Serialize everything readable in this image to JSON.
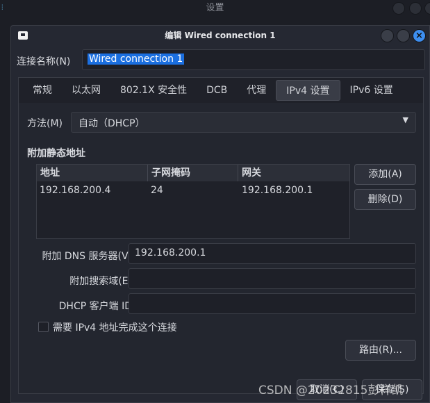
{
  "background": {
    "title": "设置"
  },
  "dialog": {
    "title": "编辑 Wired connection 1",
    "close_icon": "×"
  },
  "connection_name": {
    "label": "连接名称(N)",
    "value": "Wired connection 1"
  },
  "tabs": [
    {
      "label": "常规"
    },
    {
      "label": "以太网"
    },
    {
      "label": "802.1X 安全性"
    },
    {
      "label": "DCB"
    },
    {
      "label": "代理"
    },
    {
      "label": "IPv4 设置",
      "active": true
    },
    {
      "label": "IPv6 设置"
    }
  ],
  "method": {
    "label": "方法(M)",
    "value": "自动（DHCP）"
  },
  "static": {
    "heading": "附加静态地址",
    "columns": [
      "地址",
      "子网掩码",
      "网关"
    ],
    "rows": [
      [
        "192.168.200.4",
        "24",
        "192.168.200.1"
      ]
    ],
    "add": "添加(A)",
    "delete": "删除(D)"
  },
  "dns": {
    "label": "附加 DNS 服务器(V)",
    "value": "192.168.200.1"
  },
  "search": {
    "label": "附加搜索域(E)",
    "value": ""
  },
  "dhcp_id": {
    "label": "DHCP 客户端 ID",
    "value": ""
  },
  "require": {
    "label": "需要 IPv4 地址完成这个连接",
    "checked": false
  },
  "routes": "路由(R)...",
  "footer": {
    "cancel": "取消(C)",
    "save": "保存(S)"
  },
  "watermark": "CSDN @20232815彭祥凯",
  "colors": {
    "accent": "#1b6fe0",
    "close": "#3d8ef0"
  }
}
